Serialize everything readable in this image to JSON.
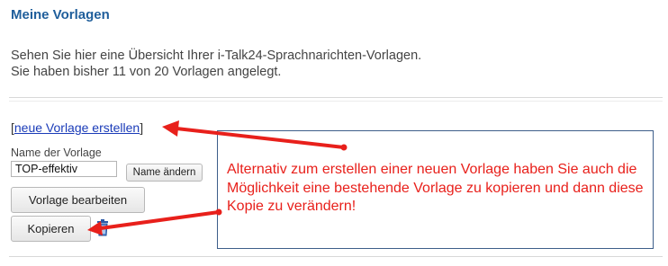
{
  "page": {
    "title": "Meine Vorlagen",
    "intro_line1": "Sehen Sie hier eine Übersicht Ihrer i-Talk24-Sprachnarichten-Vorlagen.",
    "intro_line2": "Sie haben bisher 11 von 20 Vorlagen angelegt."
  },
  "actions": {
    "bracket_open": "[",
    "create_link": "neue Vorlage erstellen",
    "bracket_close": "]"
  },
  "template": {
    "name_label": "Name der Vorlage",
    "name_value": "TOP-effektiv",
    "rename_button": "Name ändern",
    "edit_button": "Vorlage bearbeiten",
    "copy_button": "Kopieren",
    "delete_icon": "trash-icon"
  },
  "annotation": {
    "text": "Alternativ zum erstellen einer neuen Vorlage haben Sie auch die Möglichkeit eine bestehende Vorlage zu kopieren und dann diese Kopie zu verändern!",
    "color": "#e8201b",
    "border_color": "#3d5e8a"
  },
  "colors": {
    "title": "#1f5e9b",
    "link": "#1a3bb8",
    "arrow": "#e8201b"
  }
}
